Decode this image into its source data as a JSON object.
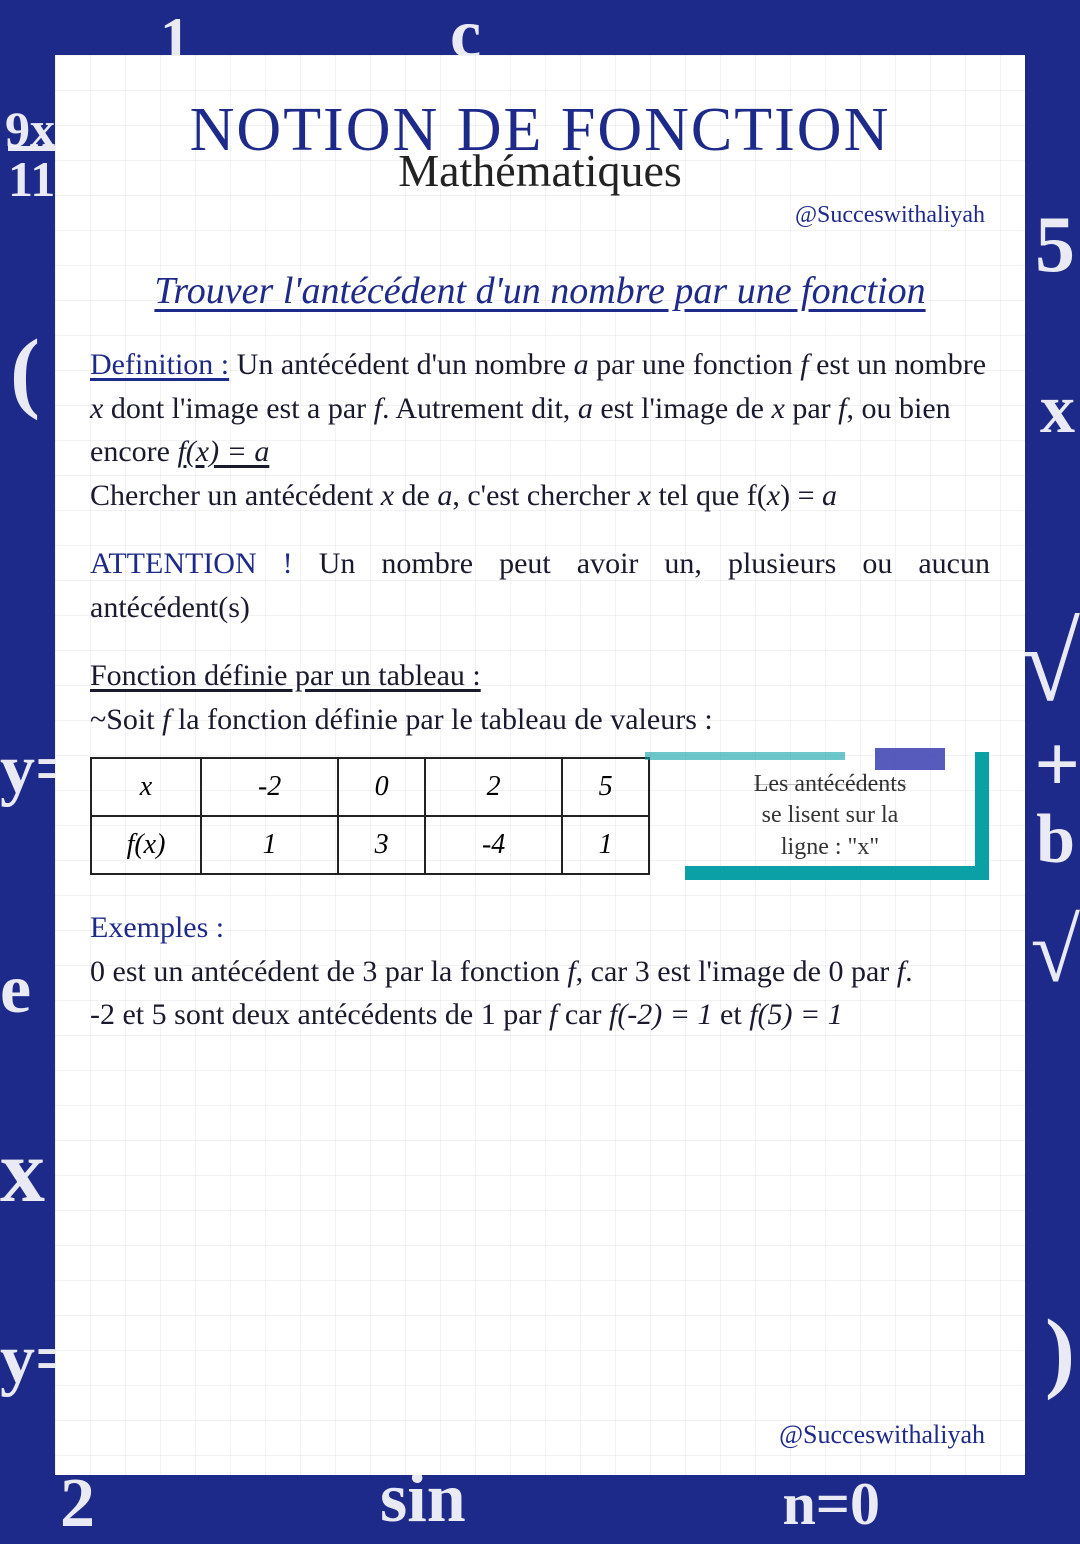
{
  "header": {
    "title": "NOTION DE FONCTION",
    "subtitle": "Mathématiques",
    "handle": "@Succeswithaliyah"
  },
  "section": {
    "title": "Trouver l'antécédent d'un nombre par une fonction"
  },
  "definition": {
    "label": "Definition :",
    "text_1a": " Un antécédent d'un nombre ",
    "a1": "a",
    "text_1b": " par une fonction ",
    "f1": "f",
    "text_1c": " est un nombre ",
    "x1": "x",
    "text_1d": " dont l'image est a par ",
    "f2": "f",
    "text_1e": ". Autrement dit, ",
    "a2": "a",
    "text_1f": " est l'image de ",
    "x2": "x",
    "text_1g": " par ",
    "f3": "f",
    "text_1h": ", ou bien encore ",
    "eq1": "f(x) = a",
    "text_2a": "Chercher un antécédent ",
    "x3": "x",
    "text_2b": " de ",
    "a3": "a",
    "text_2c": ", c'est chercher ",
    "x4": "x",
    "text_2d": " tel que f(",
    "x5": "x",
    "text_2e": ") = ",
    "a4": "a"
  },
  "attention": {
    "label": "ATTENTION !",
    "text": " Un nombre peut avoir un, plusieurs ou aucun antécédent(s)"
  },
  "tableau": {
    "heading": "Fonction définie par un tableau :",
    "intro_a": "~Soit ",
    "intro_f": "f",
    "intro_b": " la fonction définie par le tableau de valeurs :",
    "row_labels": [
      "x",
      "f(x)"
    ],
    "row_x": [
      "-2",
      "0",
      "2",
      "5"
    ],
    "row_fx": [
      "1",
      "3",
      "-4",
      "1"
    ]
  },
  "note": {
    "line1": "Les antécédents",
    "line2": "se lisent sur la",
    "line3": "ligne : \"x\""
  },
  "exemples": {
    "label": "Exemples :",
    "line1a": "0 est un antécédent de 3 par la fonction ",
    "f1": "f",
    "line1b": ", car 3 est l'image de 0 par ",
    "f2": "f",
    "line1c": ".",
    "line2a": "-2 et 5 sont deux antécédents de 1 par ",
    "f3": "f",
    "line2b": " car ",
    "eq1": "f(-2) = 1",
    "line2c": " et ",
    "eq2": "f(5) = 1"
  },
  "footer": {
    "handle": "@Succeswithaliyah"
  },
  "bg_glyphs": [
    "9x",
    "11",
    "c",
    "y=",
    "e",
    "x",
    "y=",
    "5",
    "x",
    "+",
    "b",
    "√",
    "sin",
    "n=0",
    "2",
    "1",
    "√",
    "(",
    ")"
  ]
}
